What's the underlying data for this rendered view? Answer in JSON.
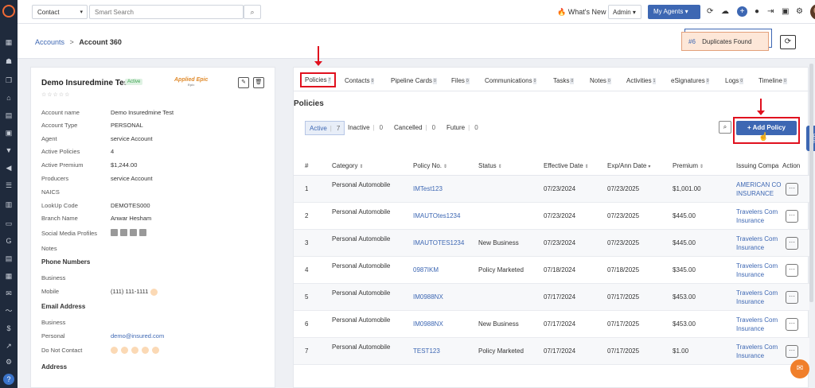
{
  "topbar": {
    "contact_select": "Contact",
    "search_placeholder": "Smart Search",
    "whats_new": "What's New",
    "admin_select": "Admin",
    "my_agents": "My Agents"
  },
  "breadcrumb": {
    "parent": "Accounts",
    "separator": ">",
    "current": "Account 360"
  },
  "duplicates": {
    "count": "#6",
    "label": "Duplicates Found"
  },
  "account": {
    "name": "Demo Insuredmine Test",
    "status": "Active",
    "partner_logo": "Applied Epic",
    "fields": [
      {
        "label": "Account name",
        "value": "Demo Insuredmine Test"
      },
      {
        "label": "Account Type",
        "value": "PERSONAL"
      },
      {
        "label": "Agent",
        "value": "service Account"
      },
      {
        "label": "Active Policies",
        "value": "4"
      },
      {
        "label": "Active Premium",
        "value": "$1,244.00"
      },
      {
        "label": "Producers",
        "value": "service Account"
      },
      {
        "label": "NAICS",
        "value": ""
      },
      {
        "label": "LookUp Code",
        "value": "DEMOTES000"
      },
      {
        "label": "Branch Name",
        "value": "Anwar Hesham"
      },
      {
        "label": "Social Media Profiles",
        "value": ""
      },
      {
        "label": "Notes",
        "value": ""
      }
    ],
    "phone_section": "Phone Numbers",
    "phone_business_label": "Business",
    "phone_mobile_label": "Mobile",
    "phone_mobile_value": "(111) 111-1111",
    "email_section": "Email Address",
    "email_business_label": "Business",
    "email_personal_label": "Personal",
    "email_personal_value": "demo@insured.com",
    "do_not_contact_label": "Do Not Contact",
    "address_section": "Address"
  },
  "tabs": [
    {
      "label": "Policies",
      "count": "7"
    },
    {
      "label": "Contacts",
      "count": "0"
    },
    {
      "label": "Pipeline Cards",
      "count": "0"
    },
    {
      "label": "Files",
      "count": "0"
    },
    {
      "label": "Communications",
      "count": "0"
    },
    {
      "label": "Tasks",
      "count": "0"
    },
    {
      "label": "Notes",
      "count": "0"
    },
    {
      "label": "Activities",
      "count": "1"
    },
    {
      "label": "eSignatures",
      "count": "0"
    },
    {
      "label": "Logs",
      "count": "0"
    },
    {
      "label": "Timeline",
      "count": "0"
    }
  ],
  "policies": {
    "title": "Policies",
    "filters": [
      {
        "label": "Active",
        "count": "7"
      },
      {
        "label": "Inactive",
        "count": "0"
      },
      {
        "label": "Cancelled",
        "count": "0"
      },
      {
        "label": "Future",
        "count": "0"
      }
    ],
    "add_button": "+ Add Policy",
    "columns": [
      "#",
      "Category",
      "Policy No.",
      "Status",
      "Effective Date",
      "Exp/Ann Date",
      "Premium",
      "Issuing Compa",
      "Action"
    ],
    "rows": [
      {
        "num": "1",
        "category": "Personal Automobile",
        "policy_no": "IMTest123",
        "status": "",
        "effective": "07/23/2024",
        "expiry": "07/23/2025",
        "premium": "$1,001.00",
        "company": "AMERICAN CO INSURANCE CO"
      },
      {
        "num": "2",
        "category": "Personal Automobile",
        "policy_no": "IMAUTOtes1234",
        "status": "",
        "effective": "07/23/2024",
        "expiry": "07/23/2025",
        "premium": "$445.00",
        "company": "Travelers Com Insurance"
      },
      {
        "num": "3",
        "category": "Personal Automobile",
        "policy_no": "IMAUTOTES1234",
        "status": "New Business",
        "effective": "07/23/2024",
        "expiry": "07/23/2025",
        "premium": "$445.00",
        "company": "Travelers Com Insurance"
      },
      {
        "num": "4",
        "category": "Personal Automobile",
        "policy_no": "0987IKM",
        "status": "Policy Marketed",
        "effective": "07/18/2024",
        "expiry": "07/18/2025",
        "premium": "$345.00",
        "company": "Travelers Com Insurance"
      },
      {
        "num": "5",
        "category": "Personal Automobile",
        "policy_no": "IM0988NX",
        "status": "",
        "effective": "07/17/2024",
        "expiry": "07/17/2025",
        "premium": "$453.00",
        "company": "Travelers Com Insurance"
      },
      {
        "num": "6",
        "category": "Personal Automobile",
        "policy_no": "IM0988NX",
        "status": "New Business",
        "effective": "07/17/2024",
        "expiry": "07/17/2025",
        "premium": "$453.00",
        "company": "Travelers Com Insurance"
      },
      {
        "num": "7",
        "category": "Personal Automobile",
        "policy_no": "TEST123",
        "status": "Policy Marketed",
        "effective": "07/17/2024",
        "expiry": "07/17/2025",
        "premium": "$1.00",
        "company": "Travelers Com Insurance"
      }
    ]
  },
  "help_tab": "Help",
  "colors": {
    "accent": "#3d67b3",
    "highlight": "#e0101e",
    "orange": "#f07f2b"
  }
}
